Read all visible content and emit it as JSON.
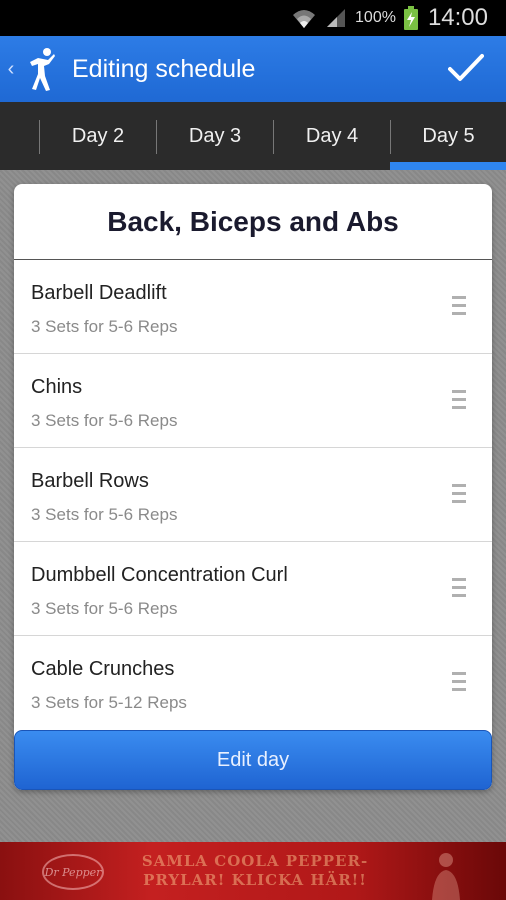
{
  "status_bar": {
    "battery": "100%",
    "time": "14:00"
  },
  "action_bar": {
    "title": "Editing schedule"
  },
  "tabs": [
    {
      "label": "",
      "selected": false
    },
    {
      "label": "Day 2",
      "selected": false
    },
    {
      "label": "Day 3",
      "selected": false
    },
    {
      "label": "Day 4",
      "selected": false
    },
    {
      "label": "Day 5",
      "selected": true
    }
  ],
  "card": {
    "title": "Back, Biceps and Abs",
    "exercises": [
      {
        "name": "Barbell Deadlift",
        "detail": "3 Sets for 5-6 Reps"
      },
      {
        "name": "Chins",
        "detail": "3 Sets for 5-6 Reps"
      },
      {
        "name": "Barbell Rows",
        "detail": "3 Sets for 5-6 Reps"
      },
      {
        "name": "Dumbbell Concentration Curl",
        "detail": "3 Sets for 5-6 Reps"
      },
      {
        "name": "Cable Crunches",
        "detail": "3 Sets for 5-12 Reps"
      }
    ],
    "edit_button": "Edit day"
  },
  "ad": {
    "logo_text": "Dr Pepper",
    "text": "SAMLA COOLA PEPPER-PRYLAR! KLICKA HÄR!!"
  },
  "colors": {
    "accent": "#2f86f0",
    "action_bar": "#1f69d4",
    "tab_bg": "#2b2b2b"
  },
  "icons": {
    "back": "chevron-left-icon",
    "logo": "runner-logo-icon",
    "confirm": "checkmark-icon",
    "handle": "drag-handle-icon"
  }
}
